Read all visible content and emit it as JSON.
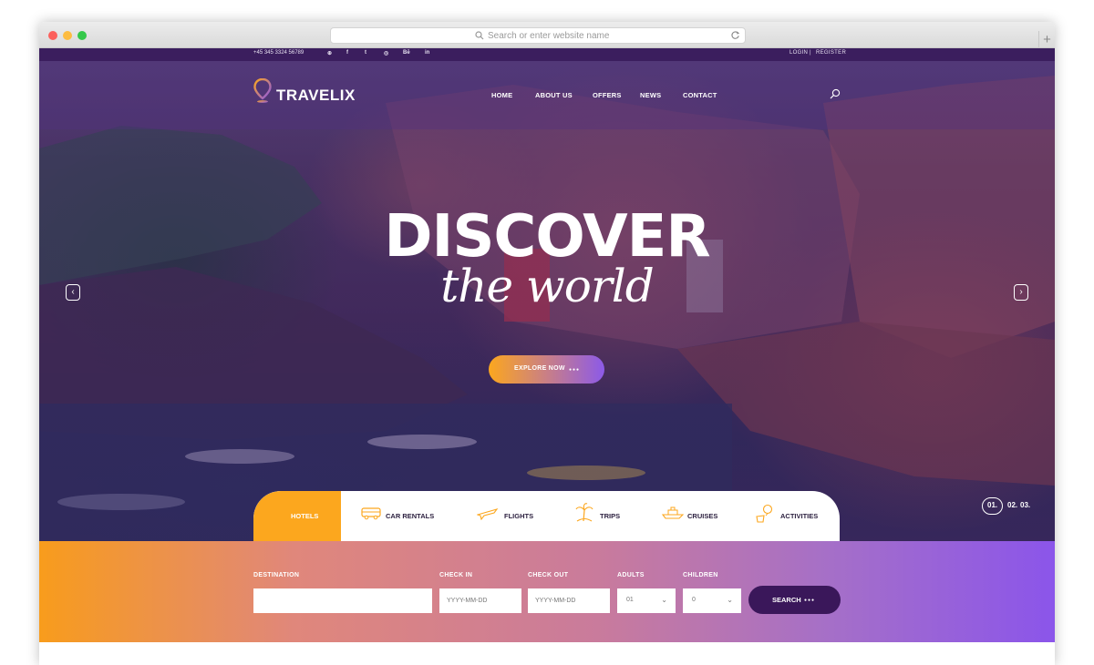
{
  "browser": {
    "url_placeholder": "Search or enter website name",
    "new_tab_glyph": "+"
  },
  "topbar": {
    "phone": "+45 345 3324 56789",
    "social_icons": [
      "pinterest-icon",
      "facebook-icon",
      "twitter-icon",
      "dribbble-icon",
      "behance-icon",
      "linkedin-icon"
    ],
    "social_glyphs": [
      "⊕",
      "f",
      "t",
      "◎",
      "Bē",
      "in"
    ],
    "login": "LOGIN",
    "separator": "|",
    "register": "REGISTER"
  },
  "nav": {
    "logo": "TRAVELIX",
    "items": [
      "HOME",
      "ABOUT US",
      "OFFERS",
      "NEWS",
      "CONTACT"
    ]
  },
  "hero": {
    "headline": "DISCOVER",
    "subline": "the world",
    "cta_label": "EXPLORE NOW",
    "cta_dots": "●●●",
    "prev_glyph": "‹",
    "next_glyph": "›",
    "slides": [
      "01.",
      "02.",
      "03."
    ],
    "active_slide": 0
  },
  "tabs": [
    {
      "label": "HOTELS",
      "icon": "hotel-icon",
      "active": true
    },
    {
      "label": "CAR RENTALS",
      "icon": "bus-icon",
      "active": false
    },
    {
      "label": "FLIGHTS",
      "icon": "airplane-icon",
      "active": false
    },
    {
      "label": "TRIPS",
      "icon": "island-icon",
      "active": false
    },
    {
      "label": "CRUISES",
      "icon": "ship-icon",
      "active": false
    },
    {
      "label": "ACTIVITIES",
      "icon": "balloon-icon",
      "active": false
    }
  ],
  "search": {
    "destination_label": "DESTINATION",
    "destination_value": "",
    "checkin_label": "CHECK IN",
    "checkin_placeholder": "YYYY-MM-DD",
    "checkout_label": "CHECK OUT",
    "checkout_placeholder": "YYYY-MM-DD",
    "adults_label": "ADULTS",
    "adults_value": "01",
    "children_label": "CHILDREN",
    "children_value": "0",
    "chevron": "⌄",
    "button_label": "SEARCH",
    "button_dots": "●●●"
  },
  "colors": {
    "accent_orange": "#fca71e",
    "accent_purple": "#8b55ea",
    "dark_purple": "#3a175a"
  }
}
